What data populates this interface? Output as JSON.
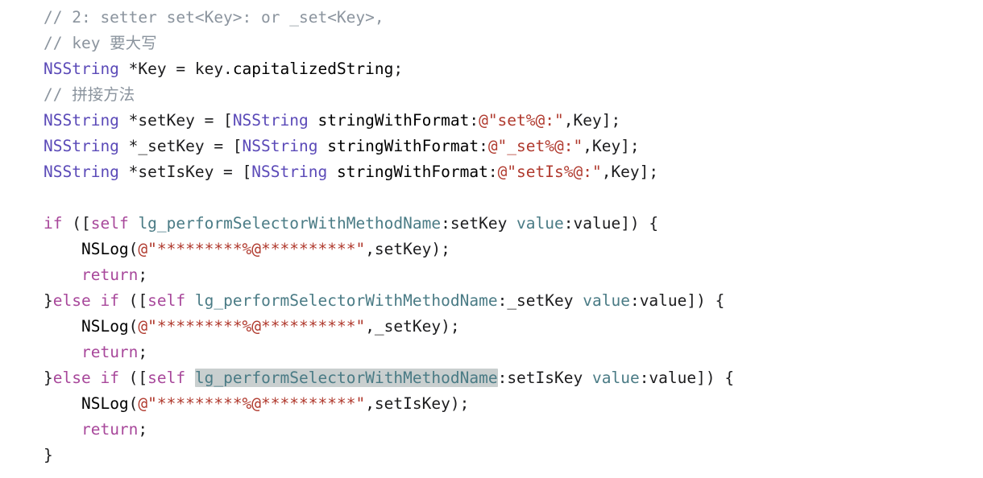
{
  "editor": {
    "language": "Objective-C",
    "background_color": "#ffffff",
    "selection_color": "#c9cfcf",
    "colors": {
      "comment": "#8b949e",
      "type": "#5b4ab8",
      "property": "#7b6fc4",
      "plain": "#1c1c1e",
      "string": "#b03a2e",
      "keyword": "#a8489b",
      "selector": "#4a7b85",
      "function": "#6c5bc4"
    },
    "lines": [
      {
        "id": 1,
        "tokens": [
          {
            "t": "// 2: setter set<Key>: or _set<Key>,",
            "c": "comment"
          }
        ]
      },
      {
        "id": 2,
        "tokens": [
          {
            "t": "// key 要大写",
            "c": "comment"
          }
        ]
      },
      {
        "id": 3,
        "tokens": [
          {
            "t": "NSString",
            "c": "type"
          },
          {
            "t": " *Key = key.",
            "c": "plain"
          },
          {
            "t": "capitalizedString",
            "c": "property"
          },
          {
            "t": ";",
            "c": "plain"
          }
        ]
      },
      {
        "id": 4,
        "tokens": [
          {
            "t": "// 拼接方法",
            "c": "comment"
          }
        ]
      },
      {
        "id": 5,
        "tokens": [
          {
            "t": "NSString",
            "c": "type"
          },
          {
            "t": " *setKey = [",
            "c": "plain"
          },
          {
            "t": "NSString",
            "c": "type"
          },
          {
            "t": " ",
            "c": "plain"
          },
          {
            "t": "stringWithFormat",
            "c": "property"
          },
          {
            "t": ":",
            "c": "plain"
          },
          {
            "t": "@\"set%@:\"",
            "c": "string"
          },
          {
            "t": ",Key];",
            "c": "plain"
          }
        ]
      },
      {
        "id": 6,
        "tokens": [
          {
            "t": "NSString",
            "c": "type"
          },
          {
            "t": " *_setKey = [",
            "c": "plain"
          },
          {
            "t": "NSString",
            "c": "type"
          },
          {
            "t": " ",
            "c": "plain"
          },
          {
            "t": "stringWithFormat",
            "c": "property"
          },
          {
            "t": ":",
            "c": "plain"
          },
          {
            "t": "@\"_set%@:\"",
            "c": "string"
          },
          {
            "t": ",Key];",
            "c": "plain"
          }
        ]
      },
      {
        "id": 7,
        "tokens": [
          {
            "t": "NSString",
            "c": "type"
          },
          {
            "t": " *setIsKey = [",
            "c": "plain"
          },
          {
            "t": "NSString",
            "c": "type"
          },
          {
            "t": " ",
            "c": "plain"
          },
          {
            "t": "stringWithFormat",
            "c": "property"
          },
          {
            "t": ":",
            "c": "plain"
          },
          {
            "t": "@\"setIs%@:\"",
            "c": "string"
          },
          {
            "t": ",Key];",
            "c": "plain"
          }
        ]
      },
      {
        "id": 8,
        "tokens": []
      },
      {
        "id": 9,
        "tokens": [
          {
            "t": "if",
            "c": "keyword"
          },
          {
            "t": " ([",
            "c": "plain"
          },
          {
            "t": "self",
            "c": "keyword"
          },
          {
            "t": " ",
            "c": "plain"
          },
          {
            "t": "lg_performSelectorWithMethodName",
            "c": "selector"
          },
          {
            "t": ":setKey ",
            "c": "plain"
          },
          {
            "t": "value",
            "c": "selector"
          },
          {
            "t": ":value]) {",
            "c": "plain"
          }
        ]
      },
      {
        "id": 10,
        "tokens": [
          {
            "t": "    ",
            "c": "plain"
          },
          {
            "t": "NSLog",
            "c": "function"
          },
          {
            "t": "(",
            "c": "plain"
          },
          {
            "t": "@\"*********%@**********\"",
            "c": "string"
          },
          {
            "t": ",setKey);",
            "c": "plain"
          }
        ]
      },
      {
        "id": 11,
        "tokens": [
          {
            "t": "    ",
            "c": "plain"
          },
          {
            "t": "return",
            "c": "keyword"
          },
          {
            "t": ";",
            "c": "plain"
          }
        ]
      },
      {
        "id": 12,
        "tokens": [
          {
            "t": "}",
            "c": "plain"
          },
          {
            "t": "else if",
            "c": "keyword"
          },
          {
            "t": " ([",
            "c": "plain"
          },
          {
            "t": "self",
            "c": "keyword"
          },
          {
            "t": " ",
            "c": "plain"
          },
          {
            "t": "lg_performSelectorWithMethodName",
            "c": "selector"
          },
          {
            "t": ":_setKey ",
            "c": "plain"
          },
          {
            "t": "value",
            "c": "selector"
          },
          {
            "t": ":value]) {",
            "c": "plain"
          }
        ]
      },
      {
        "id": 13,
        "tokens": [
          {
            "t": "    ",
            "c": "plain"
          },
          {
            "t": "NSLog",
            "c": "function"
          },
          {
            "t": "(",
            "c": "plain"
          },
          {
            "t": "@\"*********%@**********\"",
            "c": "string"
          },
          {
            "t": ",_setKey);",
            "c": "plain"
          }
        ]
      },
      {
        "id": 14,
        "tokens": [
          {
            "t": "    ",
            "c": "plain"
          },
          {
            "t": "return",
            "c": "keyword"
          },
          {
            "t": ";",
            "c": "plain"
          }
        ]
      },
      {
        "id": 15,
        "tokens": [
          {
            "t": "}",
            "c": "plain"
          },
          {
            "t": "else if",
            "c": "keyword"
          },
          {
            "t": " ([",
            "c": "plain"
          },
          {
            "t": "self",
            "c": "keyword"
          },
          {
            "t": " ",
            "c": "plain"
          },
          {
            "t": "lg_performSelectorWithMethodName",
            "c": "selector",
            "selected": true
          },
          {
            "t": ":setIsKey ",
            "c": "plain"
          },
          {
            "t": "value",
            "c": "selector"
          },
          {
            "t": ":value]) {",
            "c": "plain"
          }
        ]
      },
      {
        "id": 16,
        "tokens": [
          {
            "t": "    ",
            "c": "plain"
          },
          {
            "t": "NSLog",
            "c": "function"
          },
          {
            "t": "(",
            "c": "plain"
          },
          {
            "t": "@\"*********%@**********\"",
            "c": "string"
          },
          {
            "t": ",setIsKey);",
            "c": "plain"
          }
        ]
      },
      {
        "id": 17,
        "tokens": [
          {
            "t": "    ",
            "c": "plain"
          },
          {
            "t": "return",
            "c": "keyword"
          },
          {
            "t": ";",
            "c": "plain"
          }
        ]
      },
      {
        "id": 18,
        "tokens": [
          {
            "t": "}",
            "c": "plain"
          }
        ]
      }
    ]
  }
}
